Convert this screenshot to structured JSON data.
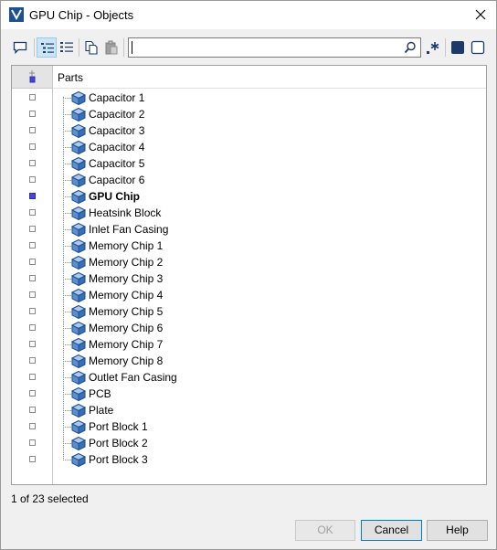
{
  "window": {
    "title": "GPU Chip - Objects"
  },
  "toolbar": {
    "search_value": "",
    "buttons": [
      "comment-icon",
      "tree-view-icon",
      "list-view-icon",
      "copy-icon",
      "paste-icon",
      "regex-icon",
      "solid-square-icon",
      "outline-square-icon"
    ]
  },
  "tree": {
    "header": "Parts",
    "items": [
      {
        "label": "Capacitor 1",
        "checked": false,
        "bold": false
      },
      {
        "label": "Capacitor 2",
        "checked": false,
        "bold": false
      },
      {
        "label": "Capacitor 3",
        "checked": false,
        "bold": false
      },
      {
        "label": "Capacitor 4",
        "checked": false,
        "bold": false
      },
      {
        "label": "Capacitor 5",
        "checked": false,
        "bold": false
      },
      {
        "label": "Capacitor 6",
        "checked": false,
        "bold": false
      },
      {
        "label": "GPU Chip",
        "checked": true,
        "bold": true
      },
      {
        "label": "Heatsink Block",
        "checked": false,
        "bold": false
      },
      {
        "label": "Inlet Fan Casing",
        "checked": false,
        "bold": false
      },
      {
        "label": "Memory Chip 1",
        "checked": false,
        "bold": false
      },
      {
        "label": "Memory Chip 2",
        "checked": false,
        "bold": false
      },
      {
        "label": "Memory Chip 3",
        "checked": false,
        "bold": false
      },
      {
        "label": "Memory Chip 4",
        "checked": false,
        "bold": false
      },
      {
        "label": "Memory Chip 5",
        "checked": false,
        "bold": false
      },
      {
        "label": "Memory Chip 6",
        "checked": false,
        "bold": false
      },
      {
        "label": "Memory Chip 7",
        "checked": false,
        "bold": false
      },
      {
        "label": "Memory Chip 8",
        "checked": false,
        "bold": false
      },
      {
        "label": "Outlet Fan Casing",
        "checked": false,
        "bold": false
      },
      {
        "label": "PCB",
        "checked": false,
        "bold": false
      },
      {
        "label": "Plate",
        "checked": false,
        "bold": false
      },
      {
        "label": "Port Block 1",
        "checked": false,
        "bold": false
      },
      {
        "label": "Port Block 2",
        "checked": false,
        "bold": false
      },
      {
        "label": "Port Block 3",
        "checked": false,
        "bold": false
      }
    ]
  },
  "status": {
    "text": "1 of 23 selected"
  },
  "buttons": {
    "ok": "OK",
    "cancel": "Cancel",
    "help": "Help"
  },
  "colors": {
    "selected_check": "#4646d2",
    "icon_blue": "#1d4f91",
    "active_tool": "#cce4f7"
  }
}
